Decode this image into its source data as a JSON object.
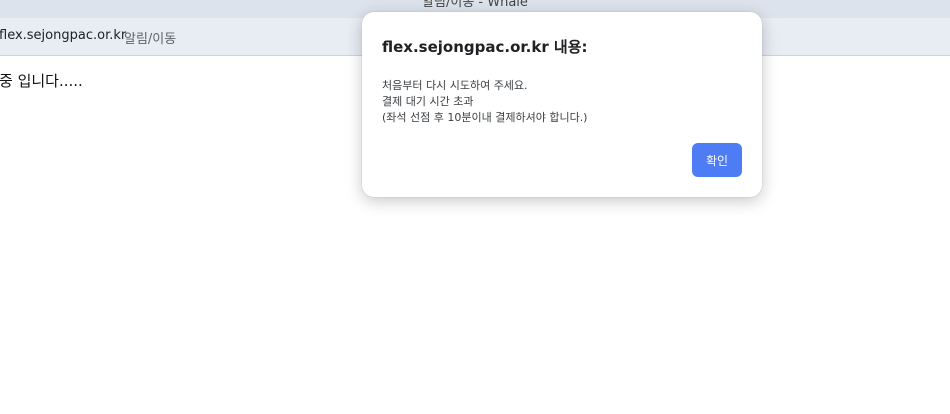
{
  "window": {
    "title": "알림/이동 - Whale"
  },
  "address_bar": {
    "domain": "flex.sejongpac.or.kr",
    "page_title": "알림/이동"
  },
  "page": {
    "content_text": "중 입니다....."
  },
  "dialog": {
    "title": "flex.sejongpac.or.kr 내용:",
    "message_lines": [
      "처음부터 다시 시도하여 주세요.",
      "결제 대기 시간 초과",
      "(좌석 선점 후 10분이내 결제하셔야 합니다.)"
    ],
    "ok_label": "확인",
    "accent_color": "#4d7cf5"
  }
}
